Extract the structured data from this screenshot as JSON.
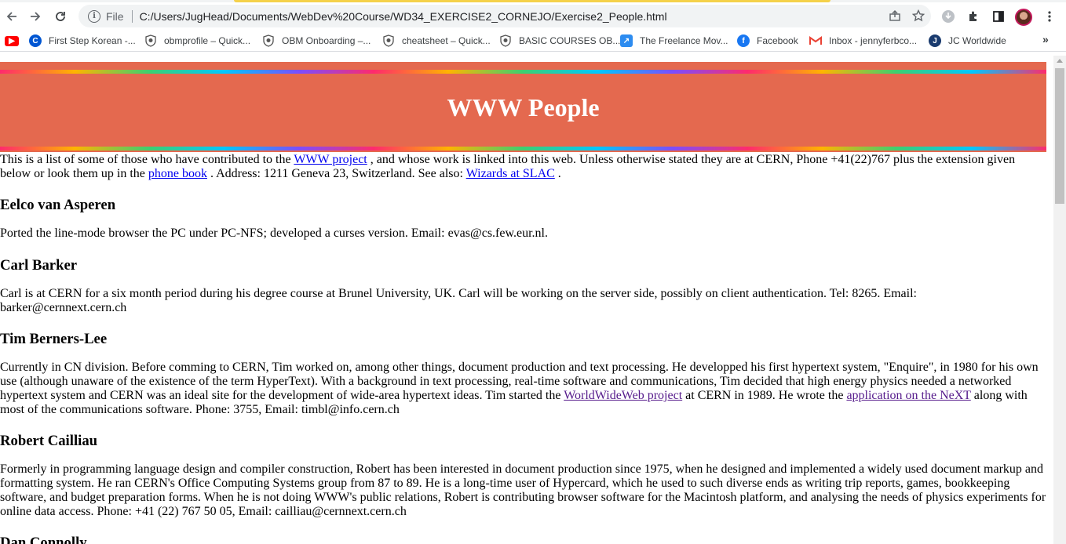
{
  "browser": {
    "omnibox": {
      "scheme_label": "File",
      "url": "C:/Users/JugHead/Documents/WebDev%20Course/WD34_EXERCISE2_CORNEJO/Exercise2_People.html"
    },
    "bookmarks": [
      {
        "label": "",
        "icon": "youtube-icon",
        "color": "#ff0000"
      },
      {
        "label": "First Step Korean -...",
        "icon": "coursera-icon",
        "color": "#0056d2"
      },
      {
        "label": "obmprofile – Quick...",
        "icon": "shield-icon",
        "color": "#555555"
      },
      {
        "label": "OBM Onboarding –...",
        "icon": "shield-icon",
        "color": "#555555"
      },
      {
        "label": "cheatsheet – Quick...",
        "icon": "shield-icon",
        "color": "#555555"
      },
      {
        "label": "BASIC COURSES OB...",
        "icon": "shield-icon",
        "color": "#555555"
      },
      {
        "label": "The Freelance Mov...",
        "icon": "freelance-icon",
        "color": "#2d8cf0"
      },
      {
        "label": "Facebook",
        "icon": "facebook-icon",
        "color": "#1877f2"
      },
      {
        "label": "Inbox - jennyferbco...",
        "icon": "gmail-icon",
        "color": "#ea4335"
      },
      {
        "label": "JC Worldwide",
        "icon": "jc-icon",
        "color": "#1a3b6e"
      }
    ],
    "more_bookmarks": "»"
  },
  "page": {
    "title": "WWW People",
    "intro": {
      "t1": "This is a list of some of those who have contributed to the ",
      "link1": "WWW project",
      "t2": " , and whose work is linked into this web. Unless otherwise stated they are at CERN, Phone +41(22)767 plus the extension given below or look them up in the ",
      "link2": "phone book",
      "t3": " . Address: 1211 Geneva 23, Switzerland. See also: ",
      "link3": "Wizards at SLAC",
      "t4": " ."
    },
    "people": [
      {
        "name": "Eelco van Asperen",
        "bio": "Ported the line-mode browser the PC under PC-NFS; developed a curses version. Email: evas@cs.few.eur.nl."
      },
      {
        "name": "Carl Barker",
        "bio": "Carl is at CERN for a six month period during his degree course at Brunel University, UK. Carl will be working on the server side, possibly on client authentication. Tel: 8265. Email: barker@cernnext.cern.ch"
      },
      {
        "name": "Tim Berners-Lee",
        "bio_t1": "Currently in CN division. Before comming to CERN, Tim worked on, among other things, document production and text processing. He developped his first hypertext system, \"Enquire\", in 1980 for his own use (although unaware of the existence of the term HyperText). With a background in text processing, real-time software and communications, Tim decided that high energy physics needed a networked hypertext system and CERN was an ideal site for the development of wide-area hypertext ideas. Tim started the ",
        "bio_link1": "WorldWideWeb project",
        "bio_t2": " at CERN in 1989. He wrote the ",
        "bio_link2": "application on the NeXT",
        "bio_t3": " along with most of the communications software. Phone: 3755, Email: timbl@info.cern.ch"
      },
      {
        "name": "Robert Cailliau",
        "bio": "Formerly in programming language design and compiler construction, Robert has been interested in document production since 1975, when he designed and implemented a widely used document markup and formatting system. He ran CERN's Office Computing Systems group from 87 to 89. He is a long-time user of Hypercard, which he used to such diverse ends as writing trip reports, games, bookkeeping software, and budget preparation forms. When he is not doing WWW's public relations, Robert is contributing browser software for the Macintosh platform, and analysing the needs of physics experiments for online data access. Phone: +41 (22) 767 50 05, Email: cailliau@cernnext.cern.ch"
      },
      {
        "name": "Dan Connolly"
      }
    ]
  },
  "colors": {
    "banner": "#e4694f",
    "link": "#0000ee",
    "visited_link": "#551a8b"
  }
}
